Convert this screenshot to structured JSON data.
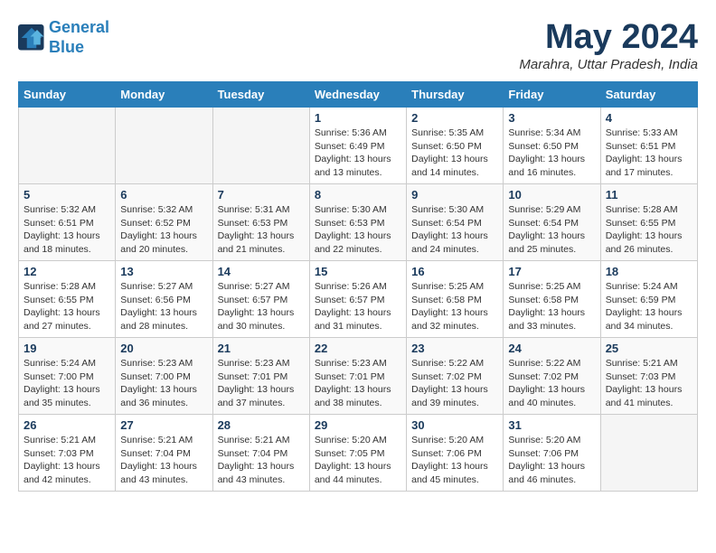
{
  "header": {
    "logo_line1": "General",
    "logo_line2": "Blue",
    "month_title": "May 2024",
    "location": "Marahra, Uttar Pradesh, India"
  },
  "days_of_week": [
    "Sunday",
    "Monday",
    "Tuesday",
    "Wednesday",
    "Thursday",
    "Friday",
    "Saturday"
  ],
  "weeks": [
    [
      {
        "day": "",
        "info": ""
      },
      {
        "day": "",
        "info": ""
      },
      {
        "day": "",
        "info": ""
      },
      {
        "day": "1",
        "info": "Sunrise: 5:36 AM\nSunset: 6:49 PM\nDaylight: 13 hours\nand 13 minutes."
      },
      {
        "day": "2",
        "info": "Sunrise: 5:35 AM\nSunset: 6:50 PM\nDaylight: 13 hours\nand 14 minutes."
      },
      {
        "day": "3",
        "info": "Sunrise: 5:34 AM\nSunset: 6:50 PM\nDaylight: 13 hours\nand 16 minutes."
      },
      {
        "day": "4",
        "info": "Sunrise: 5:33 AM\nSunset: 6:51 PM\nDaylight: 13 hours\nand 17 minutes."
      }
    ],
    [
      {
        "day": "5",
        "info": "Sunrise: 5:32 AM\nSunset: 6:51 PM\nDaylight: 13 hours\nand 18 minutes."
      },
      {
        "day": "6",
        "info": "Sunrise: 5:32 AM\nSunset: 6:52 PM\nDaylight: 13 hours\nand 20 minutes."
      },
      {
        "day": "7",
        "info": "Sunrise: 5:31 AM\nSunset: 6:53 PM\nDaylight: 13 hours\nand 21 minutes."
      },
      {
        "day": "8",
        "info": "Sunrise: 5:30 AM\nSunset: 6:53 PM\nDaylight: 13 hours\nand 22 minutes."
      },
      {
        "day": "9",
        "info": "Sunrise: 5:30 AM\nSunset: 6:54 PM\nDaylight: 13 hours\nand 24 minutes."
      },
      {
        "day": "10",
        "info": "Sunrise: 5:29 AM\nSunset: 6:54 PM\nDaylight: 13 hours\nand 25 minutes."
      },
      {
        "day": "11",
        "info": "Sunrise: 5:28 AM\nSunset: 6:55 PM\nDaylight: 13 hours\nand 26 minutes."
      }
    ],
    [
      {
        "day": "12",
        "info": "Sunrise: 5:28 AM\nSunset: 6:55 PM\nDaylight: 13 hours\nand 27 minutes."
      },
      {
        "day": "13",
        "info": "Sunrise: 5:27 AM\nSunset: 6:56 PM\nDaylight: 13 hours\nand 28 minutes."
      },
      {
        "day": "14",
        "info": "Sunrise: 5:27 AM\nSunset: 6:57 PM\nDaylight: 13 hours\nand 30 minutes."
      },
      {
        "day": "15",
        "info": "Sunrise: 5:26 AM\nSunset: 6:57 PM\nDaylight: 13 hours\nand 31 minutes."
      },
      {
        "day": "16",
        "info": "Sunrise: 5:25 AM\nSunset: 6:58 PM\nDaylight: 13 hours\nand 32 minutes."
      },
      {
        "day": "17",
        "info": "Sunrise: 5:25 AM\nSunset: 6:58 PM\nDaylight: 13 hours\nand 33 minutes."
      },
      {
        "day": "18",
        "info": "Sunrise: 5:24 AM\nSunset: 6:59 PM\nDaylight: 13 hours\nand 34 minutes."
      }
    ],
    [
      {
        "day": "19",
        "info": "Sunrise: 5:24 AM\nSunset: 7:00 PM\nDaylight: 13 hours\nand 35 minutes."
      },
      {
        "day": "20",
        "info": "Sunrise: 5:23 AM\nSunset: 7:00 PM\nDaylight: 13 hours\nand 36 minutes."
      },
      {
        "day": "21",
        "info": "Sunrise: 5:23 AM\nSunset: 7:01 PM\nDaylight: 13 hours\nand 37 minutes."
      },
      {
        "day": "22",
        "info": "Sunrise: 5:23 AM\nSunset: 7:01 PM\nDaylight: 13 hours\nand 38 minutes."
      },
      {
        "day": "23",
        "info": "Sunrise: 5:22 AM\nSunset: 7:02 PM\nDaylight: 13 hours\nand 39 minutes."
      },
      {
        "day": "24",
        "info": "Sunrise: 5:22 AM\nSunset: 7:02 PM\nDaylight: 13 hours\nand 40 minutes."
      },
      {
        "day": "25",
        "info": "Sunrise: 5:21 AM\nSunset: 7:03 PM\nDaylight: 13 hours\nand 41 minutes."
      }
    ],
    [
      {
        "day": "26",
        "info": "Sunrise: 5:21 AM\nSunset: 7:03 PM\nDaylight: 13 hours\nand 42 minutes."
      },
      {
        "day": "27",
        "info": "Sunrise: 5:21 AM\nSunset: 7:04 PM\nDaylight: 13 hours\nand 43 minutes."
      },
      {
        "day": "28",
        "info": "Sunrise: 5:21 AM\nSunset: 7:04 PM\nDaylight: 13 hours\nand 43 minutes."
      },
      {
        "day": "29",
        "info": "Sunrise: 5:20 AM\nSunset: 7:05 PM\nDaylight: 13 hours\nand 44 minutes."
      },
      {
        "day": "30",
        "info": "Sunrise: 5:20 AM\nSunset: 7:06 PM\nDaylight: 13 hours\nand 45 minutes."
      },
      {
        "day": "31",
        "info": "Sunrise: 5:20 AM\nSunset: 7:06 PM\nDaylight: 13 hours\nand 46 minutes."
      },
      {
        "day": "",
        "info": ""
      }
    ]
  ]
}
